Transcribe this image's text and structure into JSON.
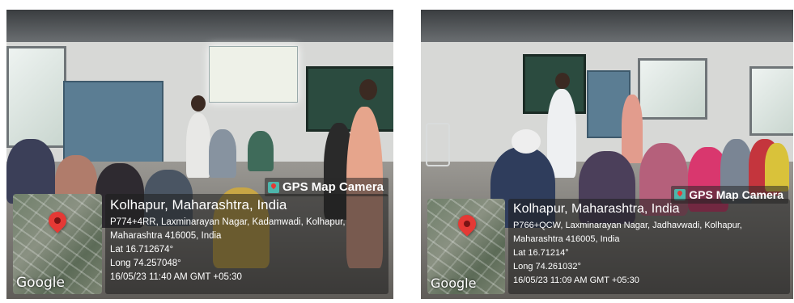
{
  "photos": [
    {
      "camera_tag": "GPS Map Camera",
      "place": "Kolhapur, Maharashtra, India",
      "address_line1": "P774+4RR, Laxminarayan Nagar, Kadamwadi, Kolhapur,",
      "address_line2": "Maharashtra 416005, India",
      "lat": "Lat 16.712674°",
      "long": "Long 74.257048°",
      "datetime": "16/05/23 11:40 AM GMT +05:30",
      "map_brand": "Google"
    },
    {
      "camera_tag": "GPS Map Camera",
      "place": "Kolhapur, Maharashtra, India",
      "address_line1": "P766+QCW, Laxminarayan Nagar, Jadhavwadi, Kolhapur,",
      "address_line2": "Maharashtra 416005, India",
      "lat": "Lat 16.71214°",
      "long": "Long 74.261032°",
      "datetime": "16/05/23 11:09 AM GMT +05:30",
      "map_brand": "Google"
    }
  ],
  "colors": {
    "pin": "#e53935",
    "overlay": "#1e1e1e",
    "overlay_text": "#ffffff"
  },
  "icons": [
    "map-pin-icon",
    "gps-camera-icon"
  ]
}
